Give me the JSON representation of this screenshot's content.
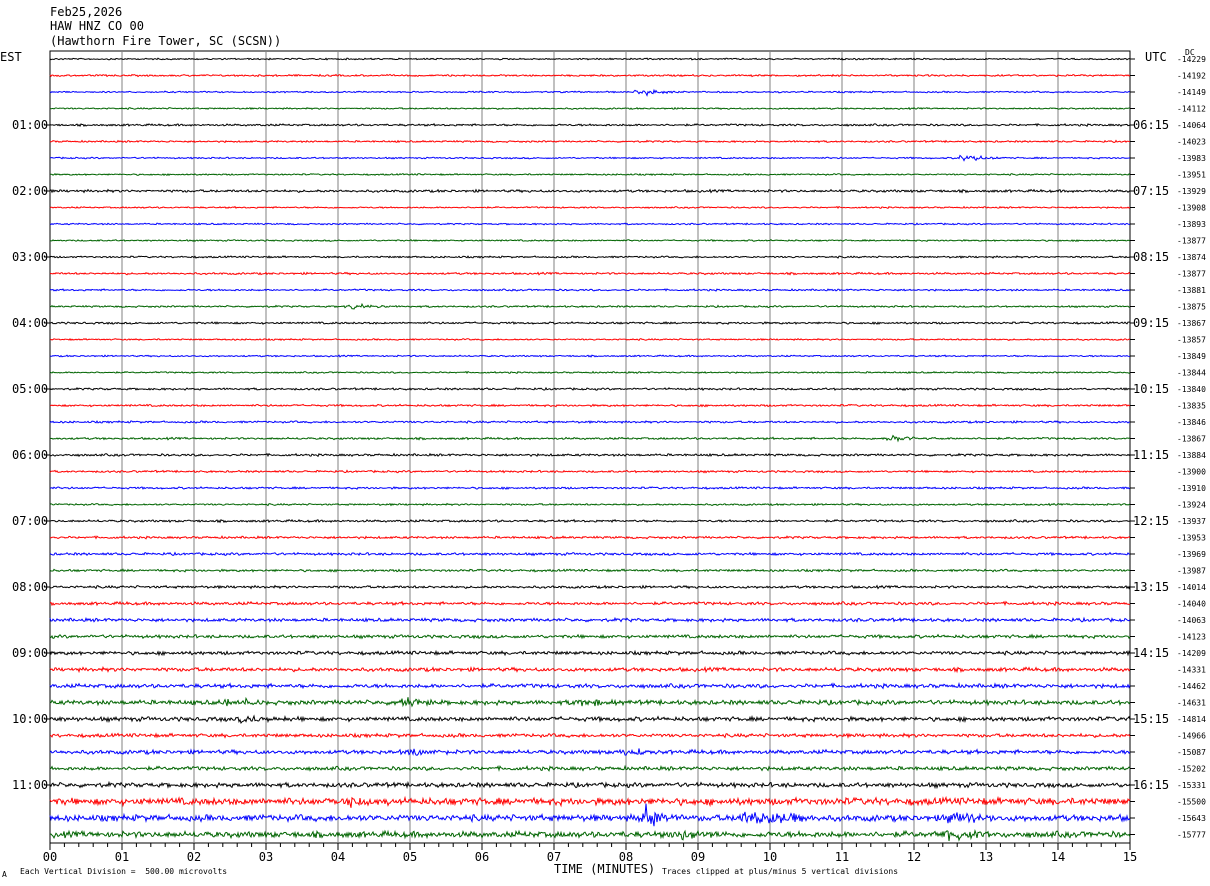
{
  "header": {
    "date": "Feb25,2026",
    "station": "HAW HNZ CO 00",
    "location": "(Hawthorn Fire Tower, SC (SCSN))"
  },
  "left_timezone": "EST",
  "right_timezone": "UTC",
  "dc_header": "DC",
  "footer": {
    "scale_text": "Each Vertical Division =  500.00 microvolts",
    "xlabel": "TIME (MINUTES)",
    "clip_text": "Traces clipped at plus/minus 5 vertical divisions",
    "corner_mark": "A"
  },
  "colors": {
    "trace_cycle": [
      "#000000",
      "#ff0000",
      "#0000ff",
      "#006400"
    ],
    "grid": "#808080"
  },
  "chart_data": {
    "type": "line",
    "title": "HAW HNZ CO 00",
    "xlabel": "TIME (MINUTES)",
    "xlim": [
      0,
      15
    ],
    "x_ticks": [
      "00",
      "01",
      "02",
      "03",
      "04",
      "05",
      "06",
      "07",
      "08",
      "09",
      "10",
      "11",
      "12",
      "13",
      "14",
      "15"
    ],
    "traces_per_hour": 4,
    "left_hour_labels": [
      "01:00",
      "02:00",
      "03:00",
      "04:00",
      "05:00",
      "06:00",
      "07:00",
      "08:00",
      "09:00",
      "10:00",
      "11:00"
    ],
    "right_hour_labels": [
      "06:15",
      "07:15",
      "08:15",
      "09:15",
      "10:15",
      "11:15",
      "12:15",
      "13:15",
      "14:15",
      "15:15",
      "16:15"
    ],
    "dc_offsets": [
      "-14229",
      "-14192",
      "-14149",
      "-14112",
      "-14064",
      "-14023",
      "-13983",
      "-13951",
      "-13929",
      "-13908",
      "-13893",
      "-13877",
      "-13874",
      "-13877",
      "-13881",
      "-13875",
      "-13867",
      "-13857",
      "-13849",
      "-13844",
      "-13840",
      "-13835",
      "-13846",
      "-13867",
      "-13884",
      "-13900",
      "-13910",
      "-13924",
      "-13937",
      "-13953",
      "-13969",
      "-13987",
      "-14014",
      "-14040",
      "-14063",
      "-14123",
      "-14209",
      "-14331",
      "-14462",
      "-14631",
      "-14814",
      "-14966",
      "-15087",
      "-15202",
      "-15331",
      "-15500",
      "-15643",
      "-15777"
    ],
    "noise_levels": [
      0.6,
      0.7,
      0.6,
      0.6,
      0.8,
      0.7,
      0.6,
      0.6,
      1.0,
      0.6,
      0.6,
      0.6,
      0.7,
      0.8,
      0.7,
      0.7,
      0.8,
      0.6,
      0.6,
      0.6,
      0.8,
      0.8,
      0.8,
      0.8,
      0.9,
      0.8,
      0.8,
      0.7,
      0.9,
      0.9,
      1.0,
      0.9,
      1.0,
      1.2,
      1.3,
      1.3,
      1.4,
      1.5,
      1.6,
      1.8,
      1.7,
      1.4,
      1.6,
      1.5,
      1.8,
      2.8,
      2.5,
      2.4
    ],
    "events": [
      {
        "trace": 2,
        "minute": 8.25,
        "amplitude": 6
      },
      {
        "trace": 6,
        "minute": 12.7,
        "amplitude": 5
      },
      {
        "trace": 15,
        "minute": 4.2,
        "amplitude": 3
      },
      {
        "trace": 23,
        "minute": 11.7,
        "amplitude": 4
      },
      {
        "trace": 39,
        "minute": 2.5,
        "amplitude": 6
      },
      {
        "trace": 39,
        "minute": 4.9,
        "amplitude": 5
      },
      {
        "trace": 39,
        "minute": 7.4,
        "amplitude": 5
      },
      {
        "trace": 40,
        "minute": 2.7,
        "amplitude": 4
      },
      {
        "trace": 42,
        "minute": 5.0,
        "amplitude": 4
      },
      {
        "trace": 42,
        "minute": 8.0,
        "amplitude": 4
      },
      {
        "trace": 45,
        "minute": 4.1,
        "amplitude": 6
      },
      {
        "trace": 46,
        "minute": 8.3,
        "amplitude": 14
      },
      {
        "trace": 46,
        "minute": 9.7,
        "amplitude": 10
      },
      {
        "trace": 46,
        "minute": 10.0,
        "amplitude": 12
      },
      {
        "trace": 46,
        "minute": 12.5,
        "amplitude": 9
      },
      {
        "trace": 47,
        "minute": 8.7,
        "amplitude": 7
      },
      {
        "trace": 47,
        "minute": 12.5,
        "amplitude": 7
      }
    ]
  }
}
